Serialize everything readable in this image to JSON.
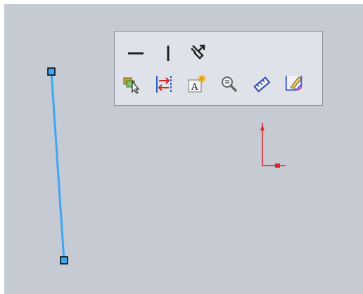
{
  "viewport": {
    "background": "#c6cbd3"
  },
  "sketch": {
    "line_color": "#3ea6f5",
    "endpoint_fill": "#3ea6f5",
    "endpoint_stroke": "#000000",
    "origin_color": "#e8202a"
  },
  "context_toolbar": {
    "row1": [
      {
        "icon": "horizontal-relation-icon"
      },
      {
        "icon": "vertical-relation-icon"
      },
      {
        "icon": "fix-relation-icon"
      }
    ],
    "row2": [
      {
        "icon": "select-other-icon"
      },
      {
        "icon": "mirror-entities-icon"
      },
      {
        "icon": "text-icon"
      },
      {
        "icon": "zoom-to-selection-icon"
      },
      {
        "icon": "smart-dimension-icon"
      },
      {
        "icon": "edit-sketch-icon"
      }
    ]
  }
}
